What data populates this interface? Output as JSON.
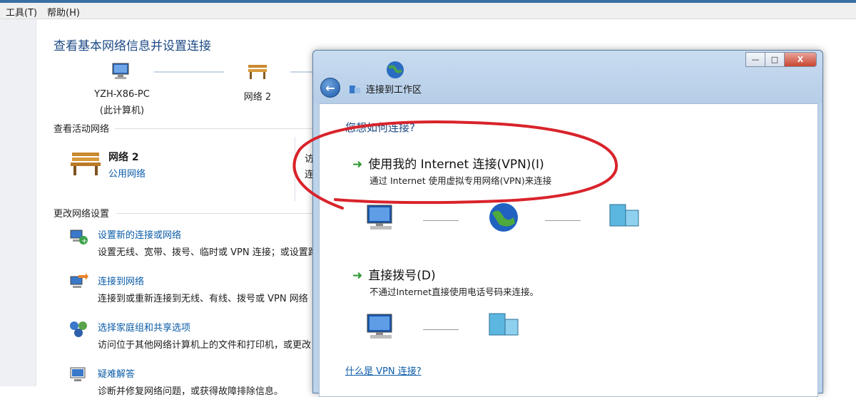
{
  "menubar": {
    "tools": "工具(T)",
    "help": "帮助(H)"
  },
  "page": {
    "title": "查看基本网络信息并设置连接",
    "net_map": {
      "computer_name": "YZH-X86-PC",
      "computer_sub": "(此计算机)",
      "network_name": "网络 2"
    },
    "active_section_title": "查看活动网络",
    "active_network": {
      "name": "网络 2",
      "type_link": "公用网络",
      "access_clip": "访",
      "conn_clip": "连"
    },
    "settings_section_title": "更改网络设置",
    "settings_items": [
      {
        "title": "设置新的连接或网络",
        "desc": "设置无线、宽带、拨号、临时或 VPN 连接；或设置路"
      },
      {
        "title": "连接到网络",
        "desc": "连接到或重新连接到无线、有线、拨号或 VPN 网络"
      },
      {
        "title": "选择家庭组和共享选项",
        "desc": "访问位于其他网络计算机上的文件和打印机，或更改"
      },
      {
        "title": "疑难解答",
        "desc": "诊断并修复网络问题，或获得故障排除信息。"
      }
    ]
  },
  "dialog": {
    "breadcrumb": "连接到工作区",
    "question": "您想如何连接?",
    "options": [
      {
        "title": "使用我的 Internet 连接(VPN)(I)",
        "desc": "通过 Internet 使用虚拟专用网络(VPN)来连接"
      },
      {
        "title": "直接拨号(D)",
        "desc": "不通过Internet直接使用电话号码来连接。"
      }
    ],
    "vpn_help_link": "什么是 VPN 连接?",
    "close_label": "X",
    "minimize_label": "—",
    "maximize_label": "□"
  },
  "annotation": {
    "circle_color": "#d9232b"
  }
}
